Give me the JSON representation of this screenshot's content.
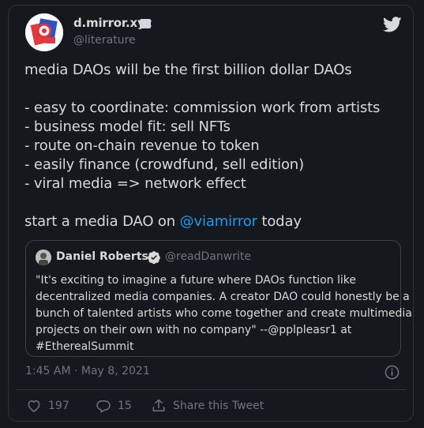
{
  "author": {
    "display_name": "d.mirror.xyz",
    "handle": "@literature"
  },
  "tweet": {
    "lines": [
      "media DAOs will be the first billion dollar DAOs",
      "- easy to coordinate: commission work from artists",
      "- business model fit: sell NFTs",
      "- route on-chain revenue to token",
      "- easily finance (crowdfund, sell edition)",
      "- viral media => network effect"
    ],
    "closing_prefix": "start a media DAO on ",
    "closing_mention": "@viamirror",
    "closing_suffix": " today"
  },
  "quote": {
    "name": "Daniel Roberts",
    "handle": "@readDanwrite",
    "lines": [
      "\"It's exciting to imagine a future where DAOs function like",
      "decentralized media companies. A creator DAO could honestly be a",
      "bunch of talented artists who come together and create multimedia",
      "projects on their own with no company\" --@pplpleasr1 at",
      "#EtherealSummit"
    ]
  },
  "meta": {
    "timestamp": "1:45 AM · May 8, 2021"
  },
  "actions": {
    "likes": "197",
    "replies": "15",
    "share_label": "Share this Tweet"
  },
  "colors": {
    "background": "#15181c",
    "text": "#d9d9d9",
    "muted": "#6e767d",
    "accent": "#1d9bf0",
    "border": "#2f3336"
  },
  "icons": {
    "brand": "twitter-bird-icon",
    "verified": "verified-badge-icon",
    "info": "info-icon",
    "like": "heart-icon",
    "reply": "reply-bubble-icon",
    "share": "share-upload-icon"
  }
}
